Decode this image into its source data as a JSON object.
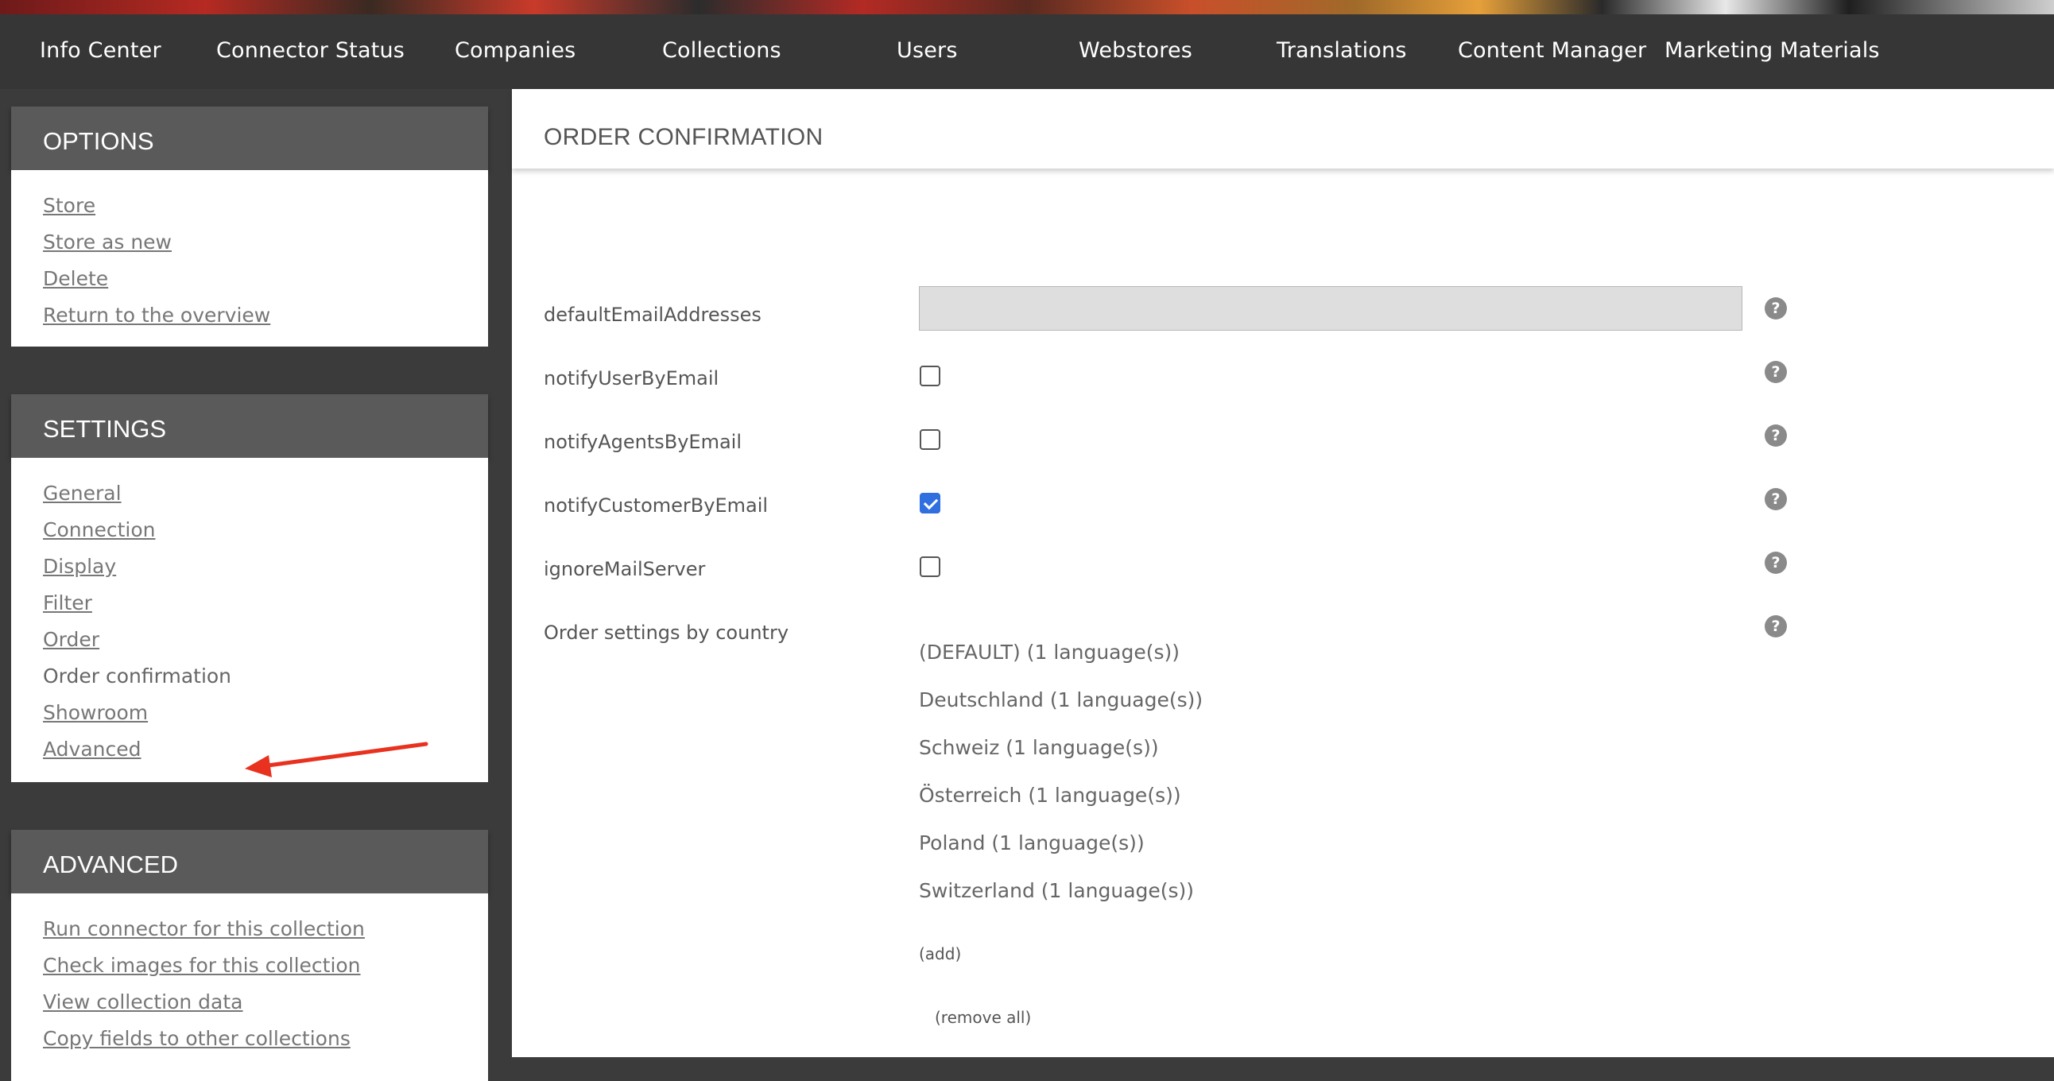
{
  "nav": {
    "items": [
      {
        "label": "Info Center"
      },
      {
        "label": "Connector Status"
      },
      {
        "label": "Companies"
      },
      {
        "label": "Collections"
      },
      {
        "label": "Users"
      },
      {
        "label": "Webstores"
      },
      {
        "label": "Translations"
      },
      {
        "label": "Content Manager"
      },
      {
        "label": "Marketing Materials"
      }
    ]
  },
  "sidebar": {
    "options": {
      "title": "OPTIONS",
      "links": [
        {
          "label": "Store"
        },
        {
          "label": "Store as new"
        },
        {
          "label": "Delete"
        },
        {
          "label": "Return to the overview"
        }
      ]
    },
    "settings": {
      "title": "SETTINGS",
      "links": [
        {
          "label": "General"
        },
        {
          "label": "Connection"
        },
        {
          "label": "Display"
        },
        {
          "label": "Filter"
        },
        {
          "label": "Order"
        },
        {
          "label": "Order confirmation",
          "active": true
        },
        {
          "label": "Showroom"
        },
        {
          "label": "Advanced"
        }
      ]
    },
    "advanced": {
      "title": "ADVANCED",
      "links": [
        {
          "label": "Run connector for this collection"
        },
        {
          "label": "Check images for this collection"
        },
        {
          "label": "View collection data"
        },
        {
          "label": "Copy fields to other collections"
        }
      ]
    }
  },
  "main": {
    "title": "ORDER CONFIRMATION",
    "fields": {
      "defaultEmailAddresses": {
        "label": "defaultEmailAddresses",
        "value": ""
      },
      "notifyUserByEmail": {
        "label": "notifyUserByEmail",
        "checked": false
      },
      "notifyAgentsByEmail": {
        "label": "notifyAgentsByEmail",
        "checked": false
      },
      "notifyCustomerByEmail": {
        "label": "notifyCustomerByEmail",
        "checked": true
      },
      "ignoreMailServer": {
        "label": "ignoreMailServer",
        "checked": false
      },
      "orderSettingsByCountry": {
        "label": "Order settings by country"
      }
    },
    "countries": [
      "(DEFAULT) (1 language(s))",
      "Deutschland (1 language(s))",
      "Schweiz (1 language(s))",
      "Österreich (1 language(s))",
      "Poland (1 language(s))",
      "Switzerland (1 language(s))"
    ],
    "add_label": "(add)",
    "remove_all_label": "(remove all)",
    "help_glyph": "?"
  },
  "colors": {
    "nav_bg": "#363636",
    "panel_header_bg": "#5a5a5a",
    "checkbox_checked": "#2f6fe0",
    "annotation_arrow": "#e8321f"
  }
}
